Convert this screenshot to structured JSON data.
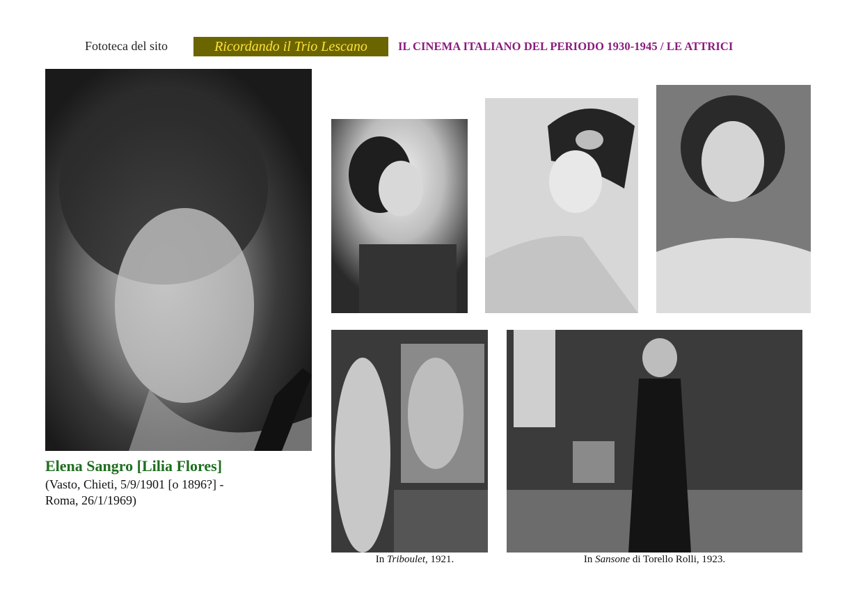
{
  "header": {
    "prefix": "Fototeca del sito",
    "site_name": "Ricordando il Trio Lescano",
    "title": "IL CINEMA ITALIANO DEL PERIODO 1930-1945 / LE ATTRICI"
  },
  "actress": {
    "name": "Elena Sangro [Lilia Flores]",
    "bio_line1": "(Vasto, Chieti, 5/9/1901 [o 1896?] -",
    "bio_line2": "Roma, 26/1/1969)"
  },
  "captions": {
    "triboulet": {
      "prefix": "In ",
      "film": "Triboulet",
      "suffix": ", 1921."
    },
    "sansone": {
      "prefix": "In ",
      "film": "Sansone",
      "suffix": " di  Torello Rolli, 1923."
    }
  },
  "colors": {
    "badge_bg": "#6b6500",
    "badge_text": "#ffe23a",
    "heading": "#8a1a7e",
    "name": "#1f6e1f"
  }
}
